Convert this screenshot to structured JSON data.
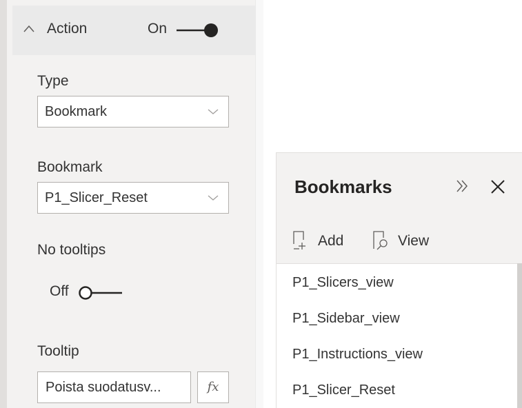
{
  "action_section": {
    "title": "Action",
    "toggle_state": "On",
    "type": {
      "label": "Type",
      "value": "Bookmark"
    },
    "bookmark": {
      "label": "Bookmark",
      "value": "P1_Slicer_Reset"
    },
    "no_tooltips": {
      "label": "No tooltips",
      "toggle_state": "Off"
    },
    "tooltip": {
      "label": "Tooltip",
      "value": "Poista suodatusv...",
      "fx_label": "fx"
    }
  },
  "bookmarks_pane": {
    "title": "Bookmarks",
    "add_label": "Add",
    "view_label": "View",
    "items": [
      "P1_Slicers_view",
      "P1_Sidebar_view",
      "P1_Instructions_view",
      "P1_Slicer_Reset"
    ]
  }
}
